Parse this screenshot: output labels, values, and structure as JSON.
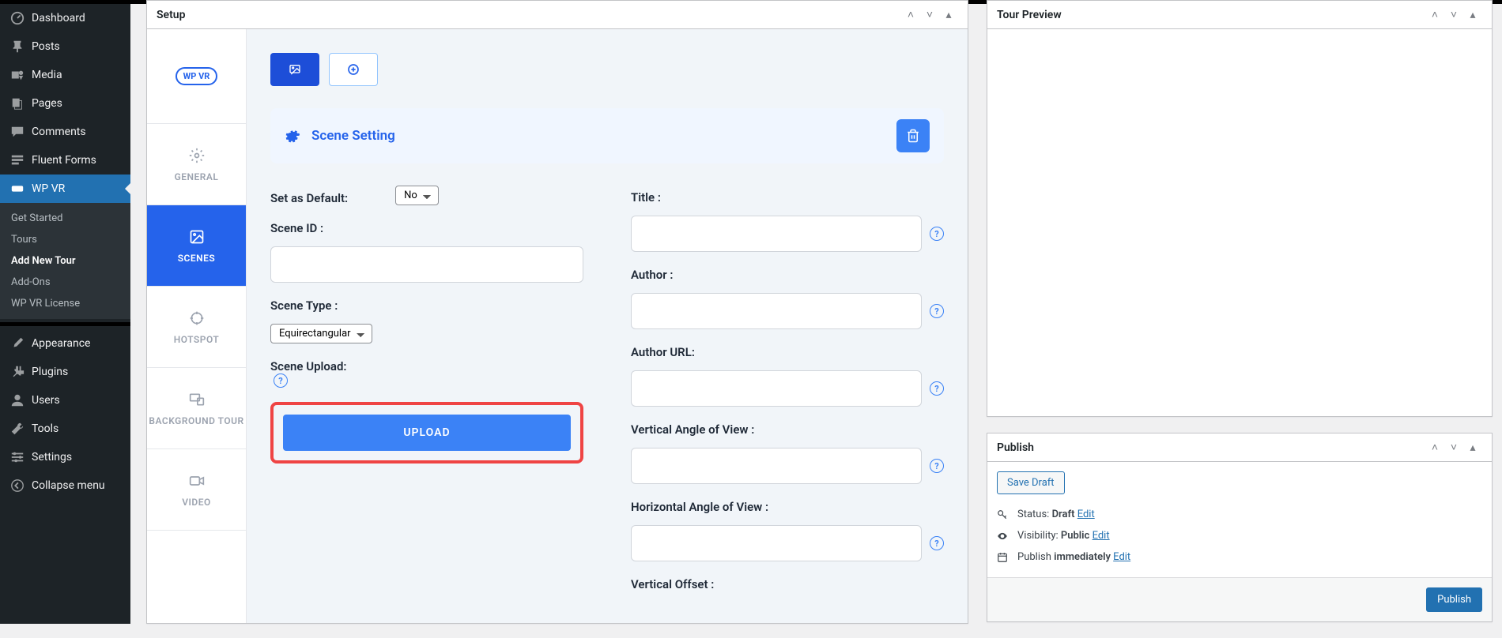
{
  "sidebar": {
    "items": [
      {
        "label": "Dashboard"
      },
      {
        "label": "Posts"
      },
      {
        "label": "Media"
      },
      {
        "label": "Pages"
      },
      {
        "label": "Comments"
      },
      {
        "label": "Fluent Forms"
      },
      {
        "label": "WP VR"
      },
      {
        "label": "Appearance"
      },
      {
        "label": "Plugins"
      },
      {
        "label": "Users"
      },
      {
        "label": "Tools"
      },
      {
        "label": "Settings"
      },
      {
        "label": "Collapse menu"
      }
    ],
    "submenu": [
      {
        "label": "Get Started"
      },
      {
        "label": "Tours"
      },
      {
        "label": "Add New Tour"
      },
      {
        "label": "Add-Ons"
      },
      {
        "label": "WP VR License"
      }
    ]
  },
  "setup": {
    "title": "Setup",
    "logo_text": "WP VR",
    "vtabs": [
      {
        "label": "GENERAL"
      },
      {
        "label": "SCENES"
      },
      {
        "label": "HOTSPOT"
      },
      {
        "label": "BACKGROUND TOUR"
      },
      {
        "label": "VIDEO"
      }
    ],
    "scene_setting": "Scene Setting",
    "labels": {
      "set_default": "Set as Default:",
      "scene_id": "Scene ID :",
      "scene_type": "Scene Type :",
      "scene_upload": "Scene Upload:",
      "title": "Title :",
      "author": "Author :",
      "author_url": "Author URL:",
      "vaov": "Vertical Angle of View :",
      "haov": "Horizontal Angle of View :",
      "voffset": "Vertical Offset :"
    },
    "default_value": "No",
    "scene_type_value": "Equirectangular",
    "upload_btn": "UPLOAD"
  },
  "preview": {
    "title": "Tour Preview"
  },
  "publish": {
    "title": "Publish",
    "save_draft": "Save Draft",
    "status_label": "Status:",
    "status_value": "Draft",
    "visibility_label": "Visibility:",
    "visibility_value": "Public",
    "publish_label": "Publish",
    "publish_value": "immediately",
    "edit": "Edit",
    "publish_btn": "Publish"
  }
}
